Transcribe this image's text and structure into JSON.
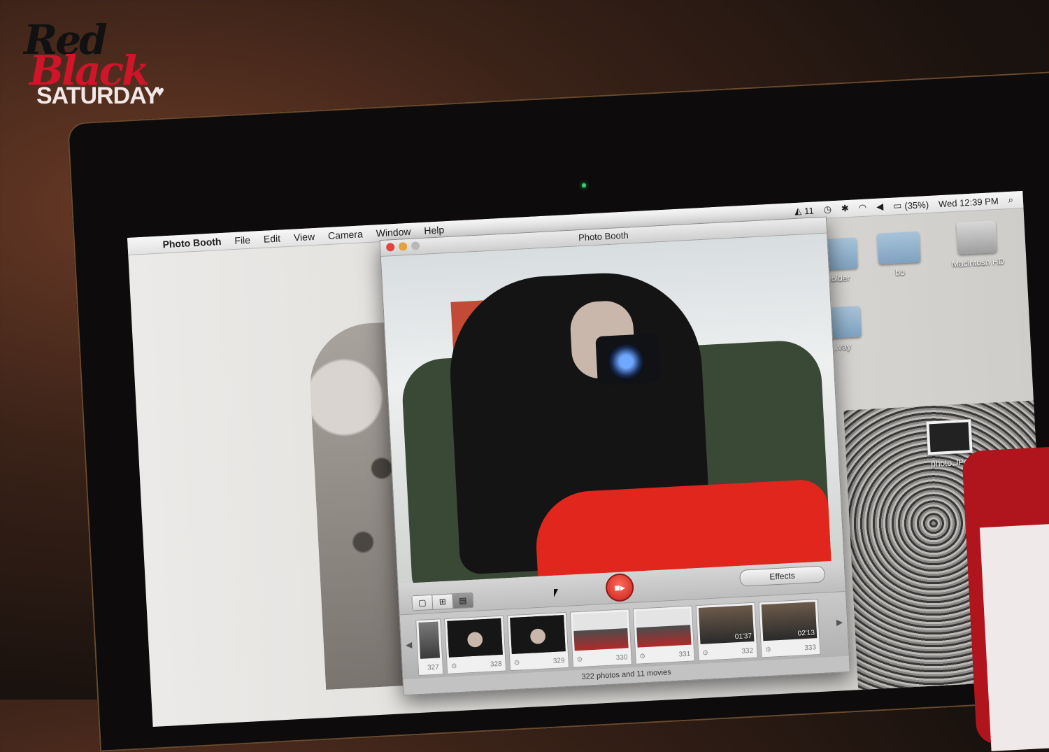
{
  "logo": {
    "line1": "Red",
    "line2": "Black",
    "line3": "SATURDAY"
  },
  "menubar": {
    "apple_icon": "apple-icon",
    "app_name": "Photo Booth",
    "menus": [
      "File",
      "Edit",
      "View",
      "Camera",
      "Window",
      "Help"
    ],
    "status": {
      "adobe": "11",
      "battery": "(35%)",
      "clock": "Wed 12:39 PM"
    }
  },
  "desktop": {
    "icons": [
      {
        "label": "Macintosh HD",
        "kind": "hard-drive"
      },
      {
        "label": "bb",
        "kind": "folder"
      },
      {
        "label": "l folder",
        "kind": "folder"
      },
      {
        "label": "...vay",
        "kind": "folder"
      },
      {
        "label": "photo.JPG",
        "kind": "image"
      }
    ]
  },
  "window": {
    "title": "Photo Booth",
    "effects_label": "Effects",
    "view_modes": [
      "single",
      "grid",
      "filmstrip"
    ],
    "thumbnails": [
      {
        "num": "327",
        "duration": ""
      },
      {
        "num": "328",
        "duration": ""
      },
      {
        "num": "329",
        "duration": ""
      },
      {
        "num": "330",
        "duration": ""
      },
      {
        "num": "331",
        "duration": ""
      },
      {
        "num": "332",
        "duration": "01'37"
      },
      {
        "num": "333",
        "duration": "02'13"
      }
    ],
    "footer": "322 photos and 11 movies"
  }
}
